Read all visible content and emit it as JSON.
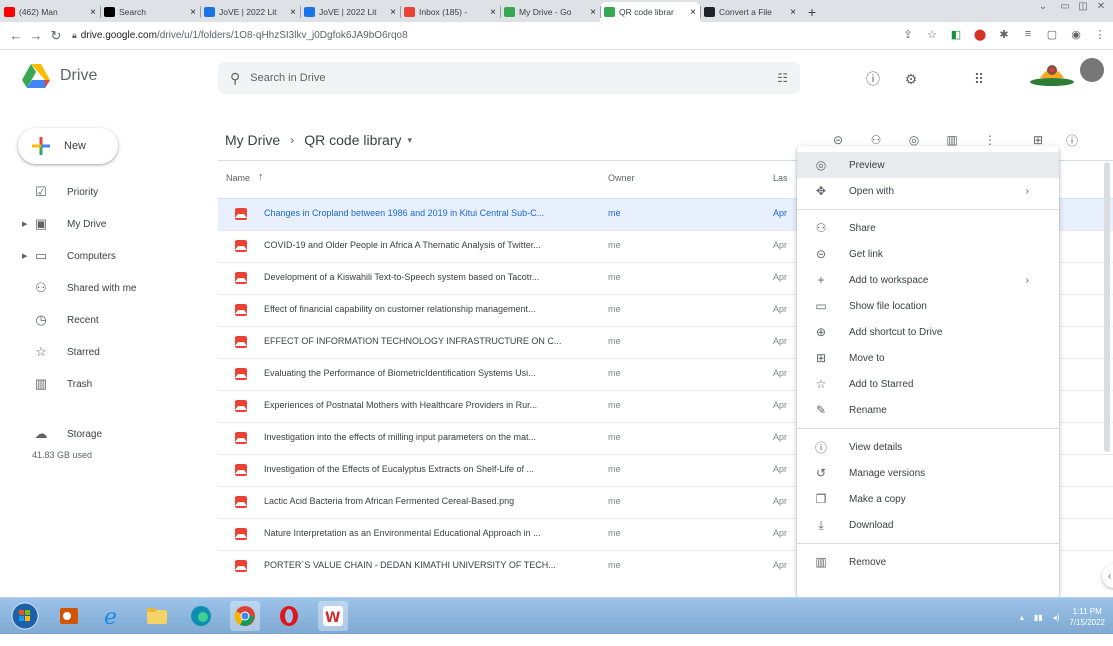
{
  "browser": {
    "tabs": [
      {
        "label": "(462) Man",
        "icon": "youtube-icon",
        "color": "#ff0000",
        "active": false
      },
      {
        "label": "Search",
        "icon": "tiktok-icon",
        "color": "#000000",
        "active": false
      },
      {
        "label": "JoVE | 2022 Lit",
        "icon": "jove-icon",
        "color": "#1a73e8",
        "active": false
      },
      {
        "label": "JoVE | 2022 Lit",
        "icon": "jove-icon",
        "color": "#1a73e8",
        "active": false
      },
      {
        "label": "Inbox (185) -",
        "icon": "gmail-icon",
        "color": "#ea4335",
        "active": false
      },
      {
        "label": "My Drive - Go",
        "icon": "drive-icon",
        "color": "#34a853",
        "active": false
      },
      {
        "label": "QR code librar",
        "icon": "drive-icon",
        "color": "#34a853",
        "active": true
      },
      {
        "label": "Convert a File",
        "icon": "convert-icon",
        "color": "#202124",
        "active": false
      }
    ],
    "url_host": "drive.google.com",
    "url_path": "/drive/u/1/folders/1O8-qHhzSI3lkv_j0Dgfok6JA9bO6rqo8"
  },
  "header": {
    "app_name": "Drive",
    "search_placeholder": "Search in Drive"
  },
  "sidebar": {
    "new_label": "New",
    "items": [
      {
        "label": "Priority",
        "icon": "priority-icon",
        "glyph": "☑",
        "expandable": false
      },
      {
        "label": "My Drive",
        "icon": "my-drive-icon",
        "glyph": "▣",
        "expandable": true
      },
      {
        "label": "Computers",
        "icon": "computers-icon",
        "glyph": "▭",
        "expandable": true
      },
      {
        "label": "Shared with me",
        "icon": "shared-icon",
        "glyph": "⚇",
        "expandable": false
      },
      {
        "label": "Recent",
        "icon": "recent-icon",
        "glyph": "◷",
        "expandable": false
      },
      {
        "label": "Starred",
        "icon": "star-icon",
        "glyph": "☆",
        "expandable": false
      },
      {
        "label": "Trash",
        "icon": "trash-icon",
        "glyph": "▥",
        "expandable": false
      }
    ],
    "storage_label": "Storage",
    "storage_used": "41.83 GB used"
  },
  "main": {
    "breadcrumb_root": "My Drive",
    "breadcrumb_current": "QR code library",
    "columns": {
      "name": "Name",
      "owner": "Owner",
      "last": "Las"
    },
    "files": [
      {
        "name": "Changes in Cropland between 1986 and 2019 in Kitui Central Sub-C...",
        "owner": "me",
        "date": "Apr",
        "selected": true
      },
      {
        "name": "COVID-19 and Older People in Africa A Thematic Analysis of Twitter...",
        "owner": "me",
        "date": "Apr",
        "selected": false
      },
      {
        "name": "Development of a Kiswahili Text-to-Speech system based on Tacotr...",
        "owner": "me",
        "date": "Apr",
        "selected": false
      },
      {
        "name": "Effect of financial capability on customer relationship management...",
        "owner": "me",
        "date": "Apr",
        "selected": false
      },
      {
        "name": "EFFECT OF INFORMATION TECHNOLOGY INFRASTRUCTURE ON C...",
        "owner": "me",
        "date": "Apr",
        "selected": false
      },
      {
        "name": "Evaluating the Performance of BiometricIdentification Systems Usi...",
        "owner": "me",
        "date": "Apr",
        "selected": false
      },
      {
        "name": "Experiences of Postnatal Mothers with Healthcare Providers in Rur...",
        "owner": "me",
        "date": "Apr",
        "selected": false
      },
      {
        "name": "Investigation into the effects of milling input parameters on the mat...",
        "owner": "me",
        "date": "Apr",
        "selected": false
      },
      {
        "name": "Investigation of the Effects of Eucalyptus Extracts on Shelf-Life of ...",
        "owner": "me",
        "date": "Apr",
        "selected": false
      },
      {
        "name": "Lactic Acid Bacteria from African Fermented Cereal-Based.png",
        "owner": "me",
        "date": "Apr",
        "selected": false
      },
      {
        "name": "Nature Interpretation as an Environmental Educational Approach in ...",
        "owner": "me",
        "date": "Apr",
        "selected": false
      },
      {
        "name": "PORTER`S VALUE CHAIN - DEDAN KIMATHI UNIVERSITY OF TECH...",
        "owner": "me",
        "date": "Apr",
        "selected": false
      }
    ]
  },
  "context_menu": {
    "groups": [
      [
        {
          "label": "Preview",
          "icon": "eye-icon",
          "glyph": "◎",
          "submenu": false,
          "highlight": true
        },
        {
          "label": "Open with",
          "icon": "open-with-icon",
          "glyph": "✥",
          "submenu": true,
          "highlight": false
        }
      ],
      [
        {
          "label": "Share",
          "icon": "share-icon",
          "glyph": "⚇",
          "submenu": false,
          "highlight": false
        },
        {
          "label": "Get link",
          "icon": "link-icon",
          "glyph": "⊝",
          "submenu": false,
          "highlight": false
        },
        {
          "label": "Add to workspace",
          "icon": "plus-icon",
          "glyph": "+",
          "submenu": true,
          "highlight": false
        },
        {
          "label": "Show file location",
          "icon": "folder-icon",
          "glyph": "▭",
          "submenu": false,
          "highlight": false
        },
        {
          "label": "Add shortcut to Drive",
          "icon": "shortcut-icon",
          "glyph": "⊕",
          "submenu": false,
          "highlight": false
        },
        {
          "label": "Move to",
          "icon": "move-icon",
          "glyph": "⊞",
          "submenu": false,
          "highlight": false
        },
        {
          "label": "Add to Starred",
          "icon": "star-icon",
          "glyph": "☆",
          "submenu": false,
          "highlight": false
        },
        {
          "label": "Rename",
          "icon": "rename-icon",
          "glyph": "✎",
          "submenu": false,
          "highlight": false
        }
      ],
      [
        {
          "label": "View details",
          "icon": "info-icon",
          "glyph": "ⓘ",
          "submenu": false,
          "highlight": false
        },
        {
          "label": "Manage versions",
          "icon": "history-icon",
          "glyph": "↺",
          "submenu": false,
          "highlight": false
        },
        {
          "label": "Make a copy",
          "icon": "copy-icon",
          "glyph": "❐",
          "submenu": false,
          "highlight": false
        },
        {
          "label": "Download",
          "icon": "download-icon",
          "glyph": "⤓",
          "submenu": false,
          "highlight": false
        }
      ],
      [
        {
          "label": "Remove",
          "icon": "trash-icon",
          "glyph": "▥",
          "submenu": false,
          "highlight": false
        }
      ]
    ]
  },
  "taskbar": {
    "time": "1:11 PM",
    "date": "7/15/2022"
  },
  "colors": {
    "selected_row_bg": "#e8f0fe",
    "selected_text": "#1967d2",
    "image_file_icon": "#ea4335",
    "menu_highlight": "#e8eaed"
  }
}
